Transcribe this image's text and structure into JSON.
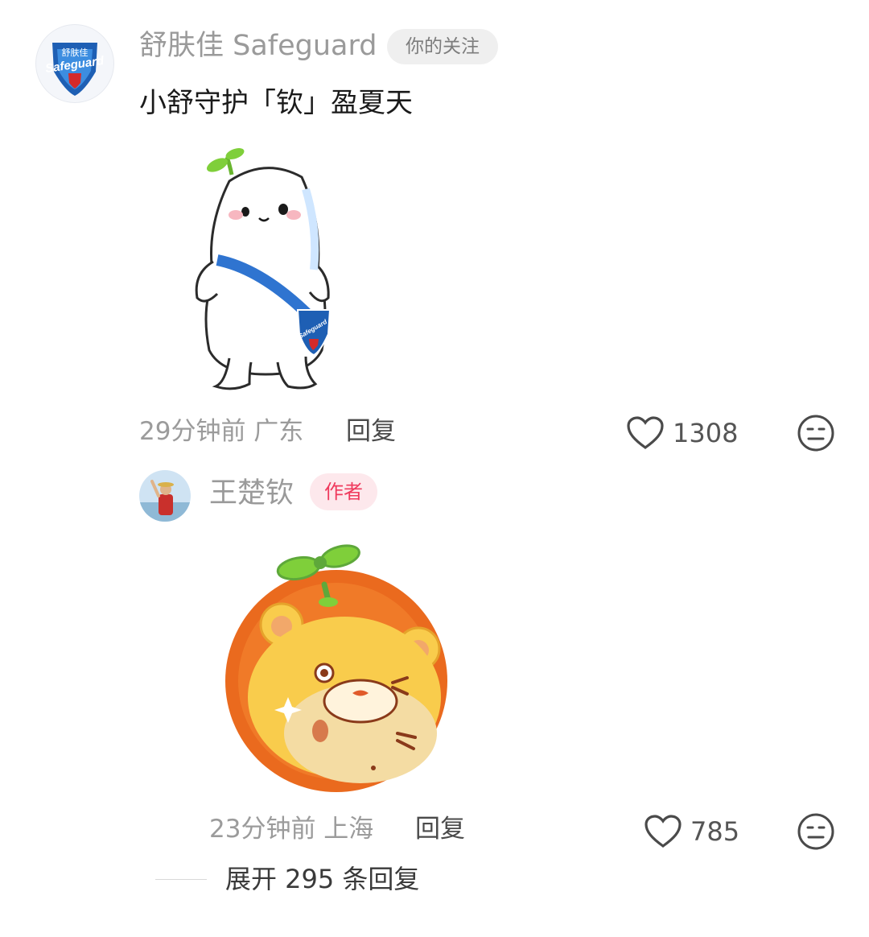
{
  "comment1": {
    "user_name": "舒肤佳 Safeguard",
    "badge": "你的关注",
    "avatar_brand_top": "舒肤佳",
    "avatar_brand_main": "Safeguard",
    "text": "小舒守护「钦」盈夏天",
    "meta": "29分钟前 广东",
    "reply_label": "回复",
    "likes": "1308",
    "sticker_brand": "Safeguard"
  },
  "comment2": {
    "user_name": "王楚钦",
    "badge": "作者",
    "meta": "23分钟前 上海",
    "reply_label": "回复",
    "likes": "785"
  },
  "expand_replies": "展开 295 条回复",
  "colors": {
    "brand_blue": "#1e5fb4",
    "brand_red": "#d42a2a",
    "author_red": "#ef3a5d",
    "lion_orange": "#ea6a1e",
    "lion_yellow": "#f9cc4c",
    "sprout_green": "#7fcf3a"
  }
}
